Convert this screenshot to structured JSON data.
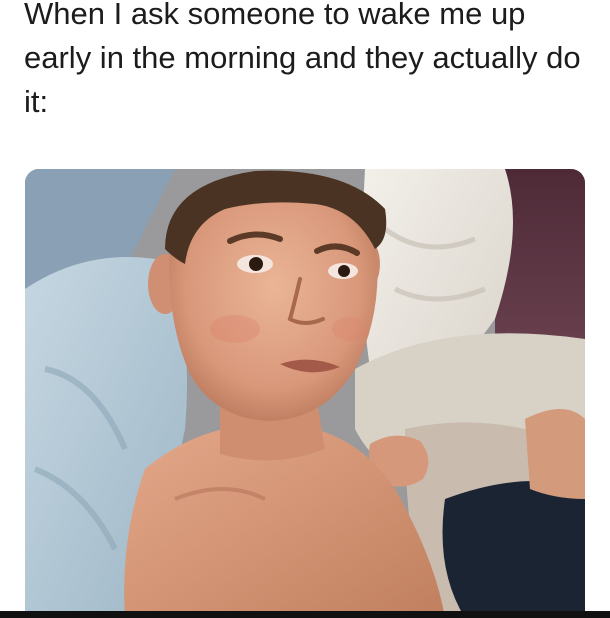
{
  "meme": {
    "caption": "When I ask someone to wake me up early in the morning and they actually do it:"
  },
  "photo": {
    "subject_colors": {
      "skin": "#e0a484",
      "skin_shadow": "#b8765a",
      "hair": "#4a3322",
      "pillow_blue": "#b9cfdc",
      "blanket_white": "#ece8e2",
      "shorts": "#1b2433",
      "background_wall": "#5a3340"
    }
  }
}
